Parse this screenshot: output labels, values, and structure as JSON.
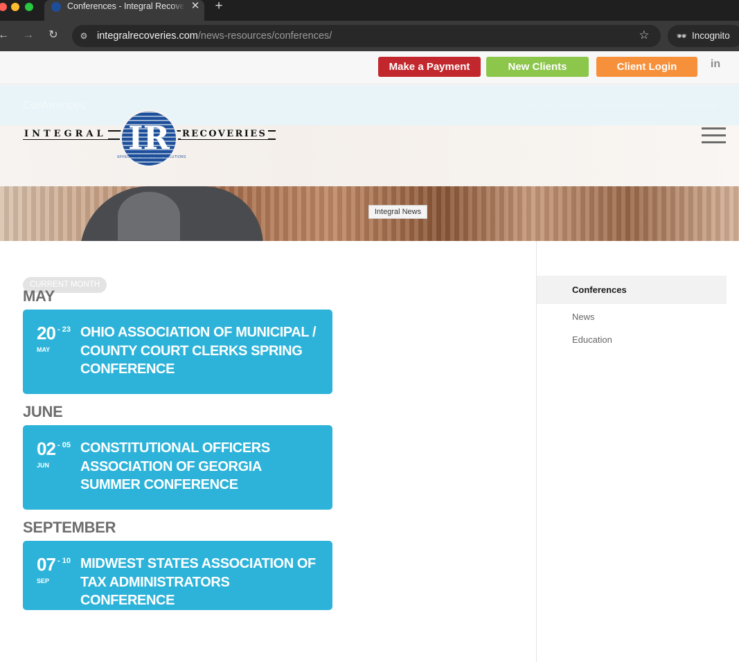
{
  "browser": {
    "tab_title": "Conferences - Integral Recoveries",
    "url_host": "integralrecoveries.com",
    "url_path": "/news-resources/conferences/",
    "incognito_label": "Incognito",
    "tab_close_glyph": "✕",
    "new_tab_glyph": "+",
    "back_glyph": "←",
    "forward_glyph": "→",
    "reload_glyph": "↻",
    "star_glyph": "☆",
    "site_info_glyph": "⚙",
    "incognito_glyph": "🕶"
  },
  "topbar": {
    "make_payment": "Make a Payment",
    "new_clients": "New Clients",
    "client_login": "Client Login",
    "linkedin_glyph": "in"
  },
  "title_strip": {
    "page_title": "Conferences",
    "breadcrumb": "You are here: Home / NEWS & RESOURCES / Conferences"
  },
  "logo": {
    "word_left": "INTEGRAL",
    "word_right": "RECOVERIES",
    "monogram": "IR",
    "tagline": "EFFECTIVE RECEIVABLE SOLUTIONS"
  },
  "hero": {
    "label": "Integral News"
  },
  "main": {
    "current_month": "CURRENT MONTH",
    "groups": [
      {
        "month": "MAY",
        "event": {
          "day": "20",
          "end": "- 23",
          "mon": "MAY",
          "title": "OHIO ASSOCIATION OF MUNICIPAL / COUNTY COURT CLERKS SPRING CONFERENCE"
        }
      },
      {
        "month": "JUNE",
        "event": {
          "day": "02",
          "end": "- 05",
          "mon": "JUN",
          "title": "CONSTITUTIONAL OFFICERS ASSOCIATION OF GEORGIA SUMMER CONFERENCE"
        }
      },
      {
        "month": "SEPTEMBER",
        "event": {
          "day": "07",
          "end": "- 10",
          "mon": "SEP",
          "title": "MIDWEST STATES ASSOCIATION OF TAX ADMINISTRATORS CONFERENCE"
        }
      }
    ]
  },
  "sidebar": {
    "items": [
      "Conferences",
      "News",
      "Education"
    ]
  },
  "colors": {
    "payment": "#c2272d",
    "clients": "#8cc64b",
    "login": "#f7903a",
    "event_card": "#2db3d9",
    "logo_blue": "#1d4f9a"
  }
}
